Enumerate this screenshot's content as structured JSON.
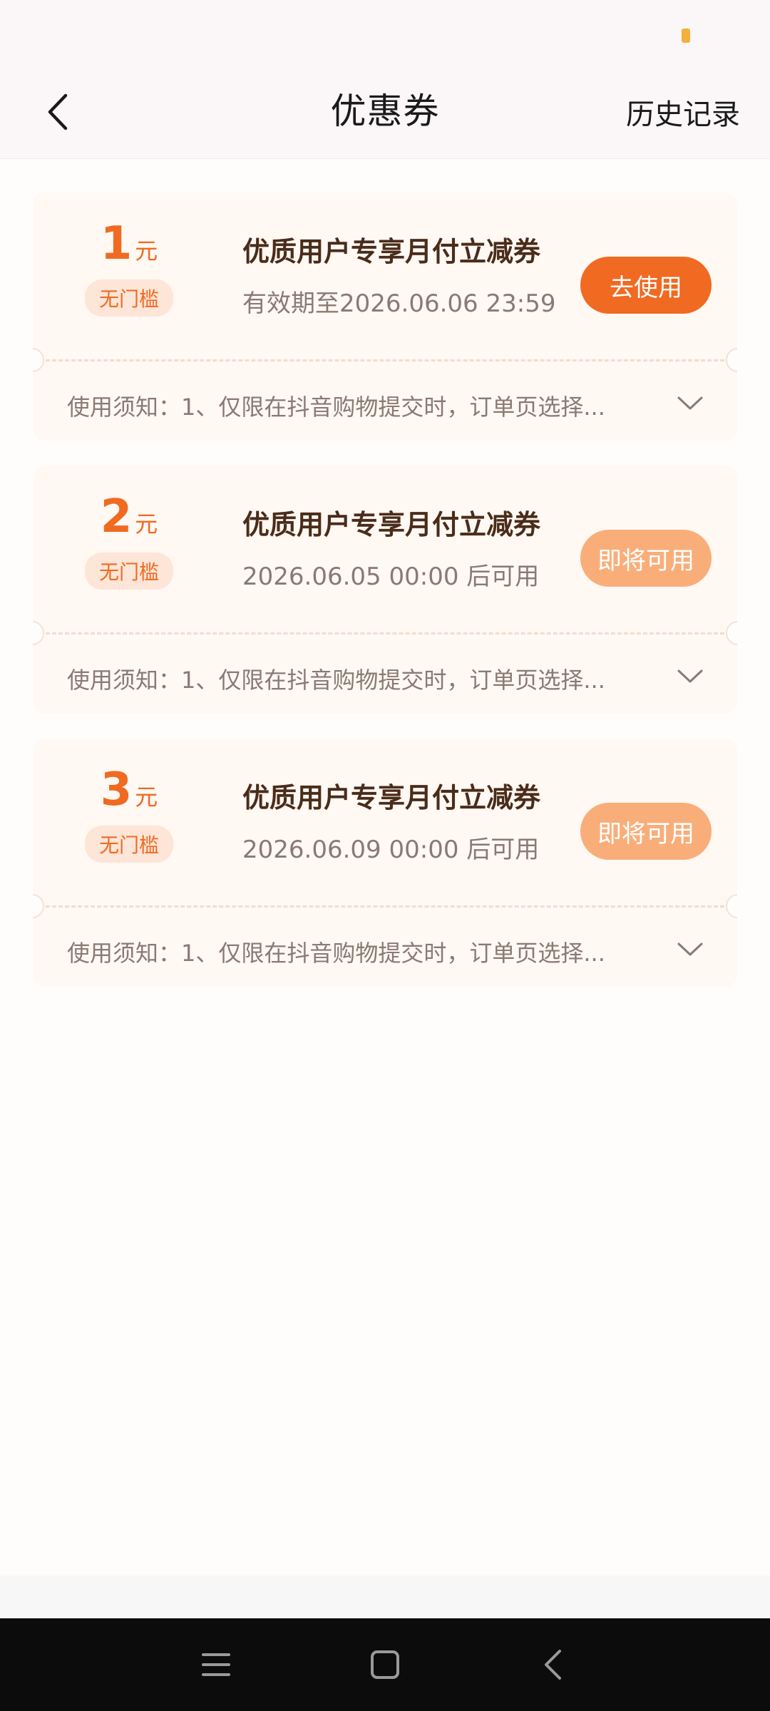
{
  "header": {
    "title": "优惠券",
    "history_label": "历史记录",
    "back_icon": "back-chevron-icon"
  },
  "colors": {
    "accent": "#f06a21",
    "accent_soft": "#f9ae7a",
    "card_bg": "#fff8f3",
    "title_text": "#4a2c1a",
    "muted_text": "#8a7a72"
  },
  "coupons": [
    {
      "amount": "1",
      "unit": "元",
      "threshold": "无门槛",
      "title": "优质用户专享月付立减券",
      "date_text": "有效期至2026.06.06 23:59",
      "button": "去使用",
      "notice": "使用须知：1、仅限在抖音购物提交时，订单页选择..."
    },
    {
      "amount": "2",
      "unit": "元",
      "threshold": "无门槛",
      "title": "优质用户专享月付立减券",
      "date_text": "2026.06.05 00:00 后可用",
      "button": "即将可用",
      "notice": "使用须知：1、仅限在抖音购物提交时，订单页选择..."
    },
    {
      "amount": "3",
      "unit": "元",
      "threshold": "无门槛",
      "title": "优质用户专享月付立减券",
      "date_text": "2026.06.09 00:00 后可用",
      "button": "即将可用",
      "notice": "使用须知：1、仅限在抖音购物提交时，订单页选择..."
    }
  ],
  "nav_bar": {
    "icons": [
      "menu-icon",
      "home-square-icon",
      "back-triangle-icon"
    ]
  }
}
